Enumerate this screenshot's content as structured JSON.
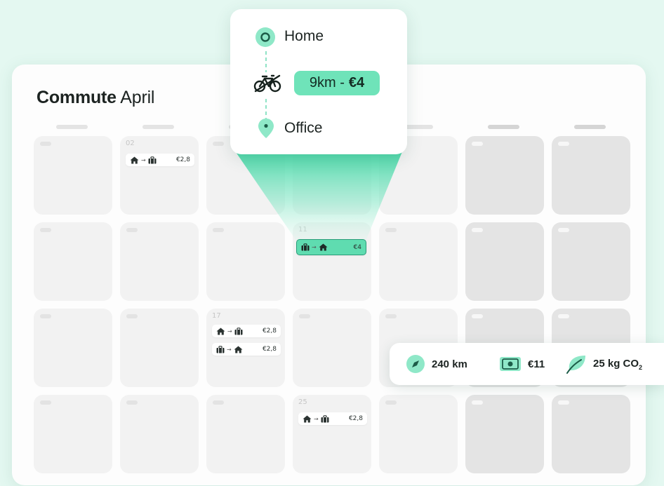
{
  "calendar": {
    "title_bold": "Commute",
    "title_month": "April"
  },
  "days": {
    "d02": "02",
    "d11": "11",
    "d17": "17",
    "d25": "25"
  },
  "trips": [
    {
      "direction": "home-to-office",
      "cost": "€2,8"
    },
    {
      "direction": "office-to-home",
      "cost": "€4"
    },
    {
      "direction": "home-to-office",
      "cost": "€2,8"
    },
    {
      "direction": "office-to-home",
      "cost": "€2,8"
    },
    {
      "direction": "home-to-office",
      "cost": "€2,8"
    }
  ],
  "popup": {
    "origin": "Home",
    "destination": "Office",
    "distance_cost_prefix": "9km -",
    "distance_cost_amount": "€4",
    "transport_icon": "bike-icon"
  },
  "stats": {
    "distance": "240 km",
    "savings": "€11",
    "co2": "25 kg CO",
    "co2_sub": "2"
  },
  "colors": {
    "background": "#e4f8f1",
    "accent": "#6fe3b9",
    "accent_dark": "#2a9d7a",
    "text": "#1c2321"
  },
  "icons": [
    "home-icon",
    "briefcase-icon",
    "arrow-right-icon",
    "bike-icon",
    "location-pin-icon",
    "compass-icon",
    "banknote-icon",
    "leaf-icon"
  ]
}
